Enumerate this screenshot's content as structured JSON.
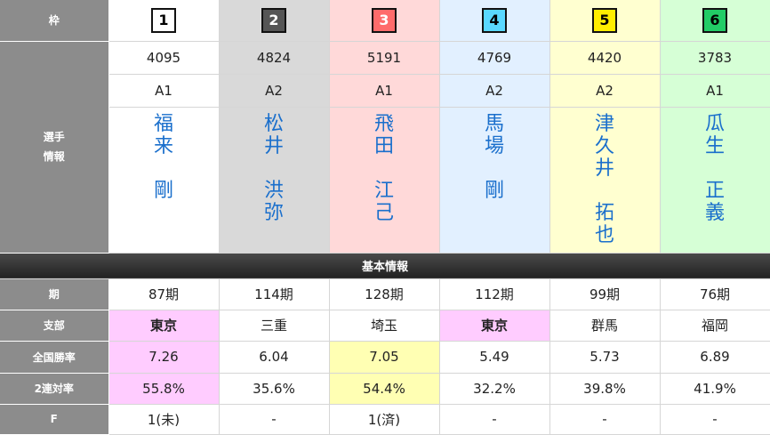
{
  "labels": {
    "waku": "枠",
    "senshu": "選手\n情報",
    "section": "基本情報",
    "ki": "期",
    "shibu": "支部",
    "zenkoku": "全国勝率",
    "niren": "2連対率",
    "f": "F"
  },
  "boats": [
    {
      "num": "1",
      "reg": "4095",
      "rank": "A1",
      "name_top": [
        "福",
        "来"
      ],
      "name_bottom": [
        "剛"
      ],
      "ki": "87期",
      "shibu": "東京",
      "win": "7.26",
      "niren": "55.8%",
      "f": "1(未)"
    },
    {
      "num": "2",
      "reg": "4824",
      "rank": "A2",
      "name_top": [
        "松",
        "井"
      ],
      "name_bottom": [
        "洪",
        "弥"
      ],
      "ki": "114期",
      "shibu": "三重",
      "win": "6.04",
      "niren": "35.6%",
      "f": "-"
    },
    {
      "num": "3",
      "reg": "5191",
      "rank": "A1",
      "name_top": [
        "飛",
        "田"
      ],
      "name_bottom": [
        "江",
        "己"
      ],
      "ki": "128期",
      "shibu": "埼玉",
      "win": "7.05",
      "niren": "54.4%",
      "f": "1(済)"
    },
    {
      "num": "4",
      "reg": "4769",
      "rank": "A2",
      "name_top": [
        "馬",
        "場"
      ],
      "name_bottom": [
        "剛"
      ],
      "ki": "112期",
      "shibu": "東京",
      "win": "5.49",
      "niren": "32.2%",
      "f": "-"
    },
    {
      "num": "5",
      "reg": "4420",
      "rank": "A2",
      "name_top": [
        "津",
        "久",
        "井"
      ],
      "name_bottom": [
        "拓",
        "也"
      ],
      "ki": "99期",
      "shibu": "群馬",
      "win": "5.73",
      "niren": "39.8%",
      "f": "-"
    },
    {
      "num": "6",
      "reg": "3783",
      "rank": "A1",
      "name_top": [
        "瓜",
        "生"
      ],
      "name_bottom": [
        "正",
        "義"
      ],
      "ki": "76期",
      "shibu": "福岡",
      "win": "6.89",
      "niren": "41.9%",
      "f": "-"
    }
  ]
}
